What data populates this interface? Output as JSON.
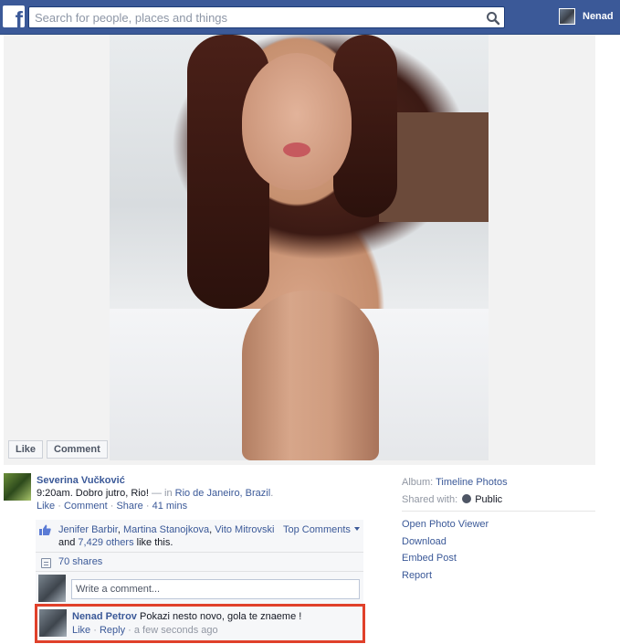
{
  "header": {
    "search_placeholder": "Search for people, places and things",
    "user_name": "Nenad",
    "logo": "f"
  },
  "photo": {
    "like_label": "Like",
    "comment_label": "Comment"
  },
  "post": {
    "author": "Severina Vučković",
    "text": "9:20am. Dobro jutro, Rio!",
    "in_prefix": " — in ",
    "location": "Rio de Janeiro, Brazil",
    "location_suffix": ".",
    "like_link": "Like",
    "comment_link": "Comment",
    "share_link": "Share",
    "time": "41 mins",
    "sep": " · "
  },
  "likes": {
    "names_1": "Jenifer Barbir",
    "names_2": "Martina Stanojkova",
    "names_3": "Vito Mitrovski",
    "and_text": " and ",
    "others": "7,429 others",
    "suffix": " like this.",
    "top_comments": "Top Comments"
  },
  "shares": {
    "label": "70 shares"
  },
  "write_comment": {
    "placeholder": "Write a comment..."
  },
  "comment": {
    "author": "Nenad Petrov",
    "text": "Pokazi nesto novo, gola te znaeme !",
    "like": "Like",
    "reply": "Reply",
    "time": "a few seconds ago"
  },
  "sidebar": {
    "album_label": "Album:",
    "album_value": "Timeline Photos",
    "shared_label": "Shared with:",
    "shared_value": "Public",
    "actions": [
      "Open Photo Viewer",
      "Download",
      "Embed Post",
      "Report"
    ]
  },
  "colors": {
    "brand": "#3b5998",
    "highlight_border": "#e0402a"
  },
  "icons": [
    "facebook-logo-icon",
    "search-icon",
    "thumbs-up-icon",
    "share-icon",
    "globe-icon",
    "chevron-down-icon"
  ]
}
